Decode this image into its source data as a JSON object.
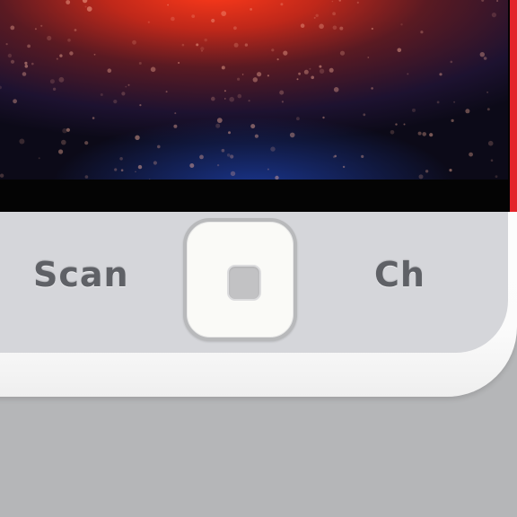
{
  "controls": {
    "left_label": "Scan",
    "right_label": "Ch"
  },
  "icons": {
    "home_button": "home-button-icon",
    "wallpaper": "starry-droplet-wallpaper"
  },
  "colors": {
    "background": "#b5b6b8",
    "panel": "#d5d6da",
    "side_rim_accent": "#e3252b",
    "label_text": "#5f6166"
  }
}
